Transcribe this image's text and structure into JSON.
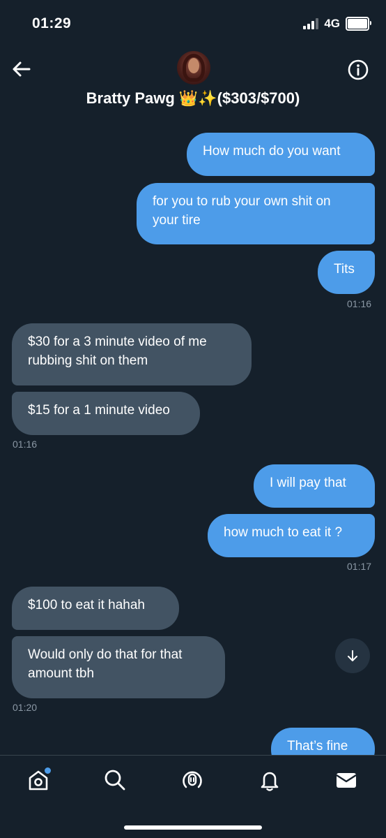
{
  "status_bar": {
    "time": "01:29",
    "network": "4G"
  },
  "header": {
    "title": "Bratty Pawg 👑✨($303/$700)"
  },
  "messages": [
    {
      "from": "me",
      "text": "How much do you want"
    },
    {
      "from": "me",
      "text": "for you to rub your own shit on your tire"
    },
    {
      "from": "me",
      "text": "Tits"
    },
    {
      "from": "them",
      "text": "$30 for a 3 minute video of me rubbing shit on them"
    },
    {
      "from": "them",
      "text": "$15 for a 1 minute video"
    },
    {
      "from": "me",
      "text": "I will pay that"
    },
    {
      "from": "me",
      "text": "how much to eat it ?"
    },
    {
      "from": "them",
      "text": "$100 to eat it hahah"
    },
    {
      "from": "them",
      "text": "Would only do that for that amount tbh"
    },
    {
      "from": "me",
      "text": "That’s fine"
    }
  ],
  "timestamps": [
    "01:16",
    "01:16",
    "01:17",
    "01:20"
  ],
  "tabs": [
    {
      "name": "home",
      "has_notification": true
    },
    {
      "name": "search"
    },
    {
      "name": "spaces"
    },
    {
      "name": "notifications"
    },
    {
      "name": "messages"
    }
  ],
  "colors": {
    "background": "#15202b",
    "outgoing_bubble": "#4d9ce9",
    "incoming_bubble": "#425363",
    "timestamp": "#8b98a5"
  }
}
